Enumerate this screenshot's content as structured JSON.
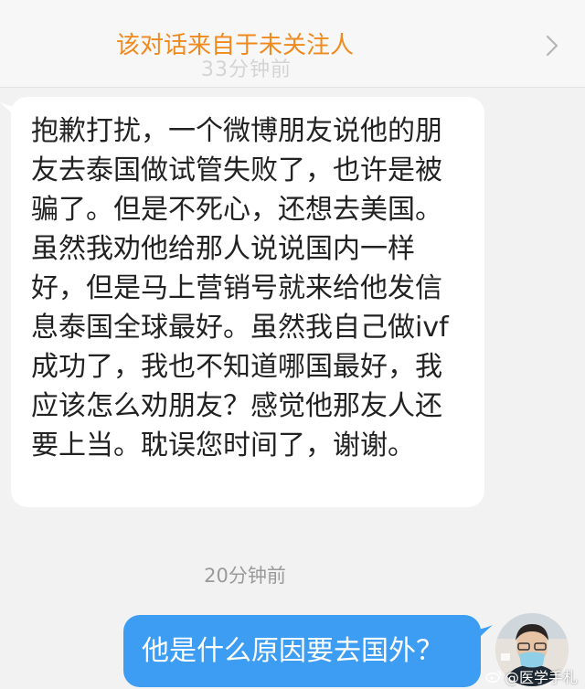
{
  "banner": {
    "text": "该对话来自于未关注人",
    "faint_text": "33分钟前"
  },
  "messages": {
    "incoming": {
      "text": "抱歉打扰，一个微博朋友说他的朋友去泰国做试管失败了，也许是被骗了。但是不死心，还想去美国。虽然我劝他给那人说说国内一样好，但是马上营销号就来给他发信息泰国全球最好。虽然我自己做ivf成功了，我也不知道哪国最好，我应该怎么劝朋友？感觉他那友人还要上当。耽误您时间了，谢谢。"
    },
    "timestamp": "20分钟前",
    "outgoing": {
      "text": "他是什么原因要去国外？"
    }
  },
  "watermark": {
    "text": "@医学手札"
  },
  "colors": {
    "banner_text": "#f08a1e",
    "outgoing_bubble": "#3d9df2",
    "incoming_bubble": "#ffffff",
    "background": "#f2f2f2"
  },
  "icons": {
    "banner_chevron": "chevron-right-icon",
    "watermark_logo": "weibo-logo-icon"
  }
}
